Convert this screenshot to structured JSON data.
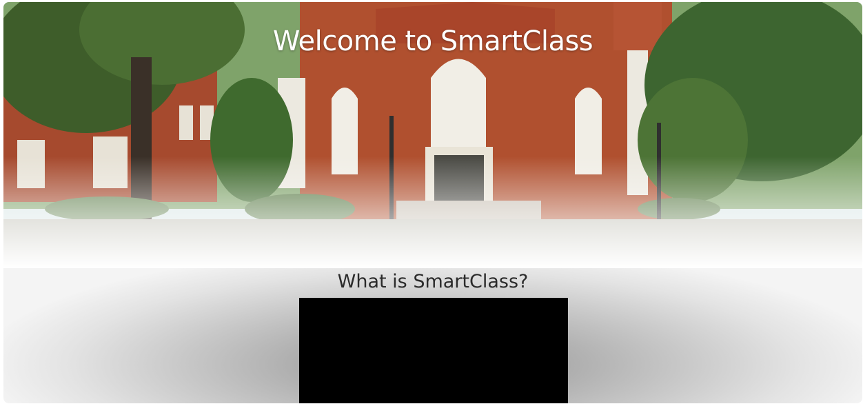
{
  "hero": {
    "title": "Welcome to SmartClass",
    "image_label": "campus-building-photo"
  },
  "about": {
    "heading": "What is SmartClass?"
  },
  "video": {
    "state": "black"
  },
  "colors": {
    "hero_title": "#ffffff",
    "heading": "#2b2b2b",
    "video_bg": "#000000",
    "brick": "#a9452a"
  }
}
